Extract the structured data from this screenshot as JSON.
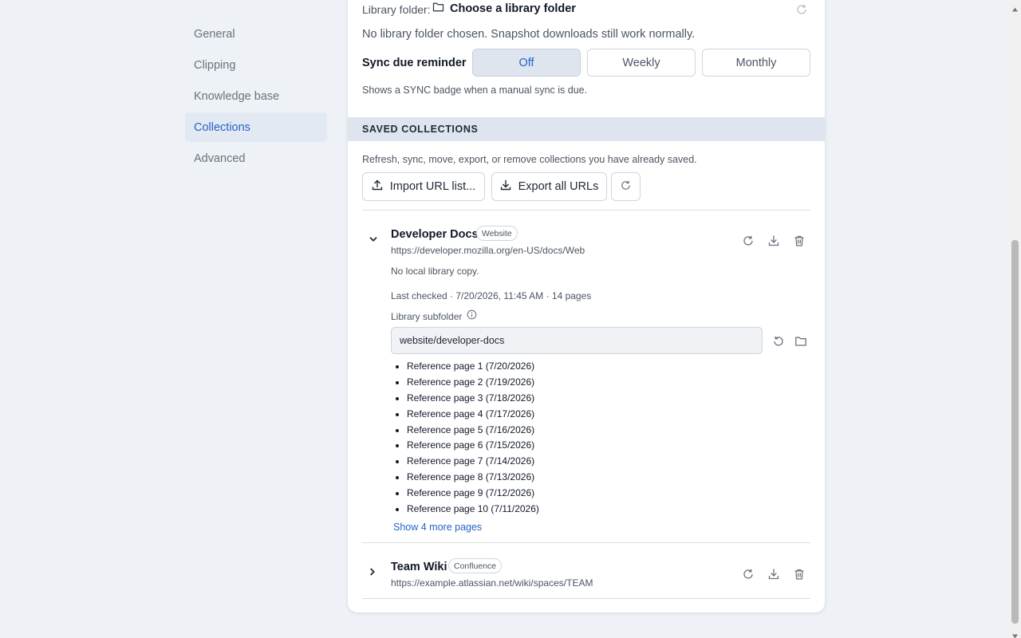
{
  "sidebar": {
    "items": [
      {
        "label": "General"
      },
      {
        "label": "Clipping"
      },
      {
        "label": "Knowledge base"
      },
      {
        "label": "Collections"
      },
      {
        "label": "Advanced"
      }
    ],
    "active": "Collections"
  },
  "library": {
    "label": "Library folder:",
    "button": "Choose a library folder",
    "status": "No library folder chosen. Snapshot downloads still work normally."
  },
  "sync": {
    "label": "Sync due reminder",
    "options": [
      "Off",
      "Weekly",
      "Monthly"
    ],
    "selected": "Off",
    "help": "Shows a SYNC badge when a manual sync is due."
  },
  "saved": {
    "heading": "SAVED COLLECTIONS",
    "description": "Refresh, sync, move, export, or remove collections you have already saved.",
    "import_label": "Import URL list...",
    "export_label": "Export all URLs"
  },
  "collections": [
    {
      "name": "Developer Docs",
      "badge": "Website",
      "url": "https://developer.mozilla.org/en-US/docs/Web",
      "expanded": true,
      "local_status": "No local library copy.",
      "last_checked": "Last checked · 7/20/2026, 11:45 AM · 14 pages",
      "subfolder_label": "Library subfolder",
      "subfolder_value": "website/developer-docs",
      "pages": [
        "Reference page 1 (7/20/2026)",
        "Reference page 2 (7/19/2026)",
        "Reference page 3 (7/18/2026)",
        "Reference page 4 (7/17/2026)",
        "Reference page 5 (7/16/2026)",
        "Reference page 6 (7/15/2026)",
        "Reference page 7 (7/14/2026)",
        "Reference page 8 (7/13/2026)",
        "Reference page 9 (7/12/2026)",
        "Reference page 10 (7/11/2026)"
      ],
      "show_more": "Show 4 more pages"
    },
    {
      "name": "Team Wiki",
      "badge": "Confluence",
      "url": "https://example.atlassian.net/wiki/spaces/TEAM",
      "expanded": false
    }
  ],
  "icons": {
    "folder": "folder-icon",
    "refresh": "refresh-icon",
    "upload": "upload-icon",
    "download": "download-icon",
    "trash": "trash-icon",
    "info": "info-icon",
    "reset": "reset-icon",
    "chevron_down": "chevron-down-icon",
    "chevron_right": "chevron-right-icon"
  },
  "colors": {
    "accent": "#2563c7",
    "page_bg": "#eef1f5",
    "section_header_bg": "#dfe5ee"
  }
}
